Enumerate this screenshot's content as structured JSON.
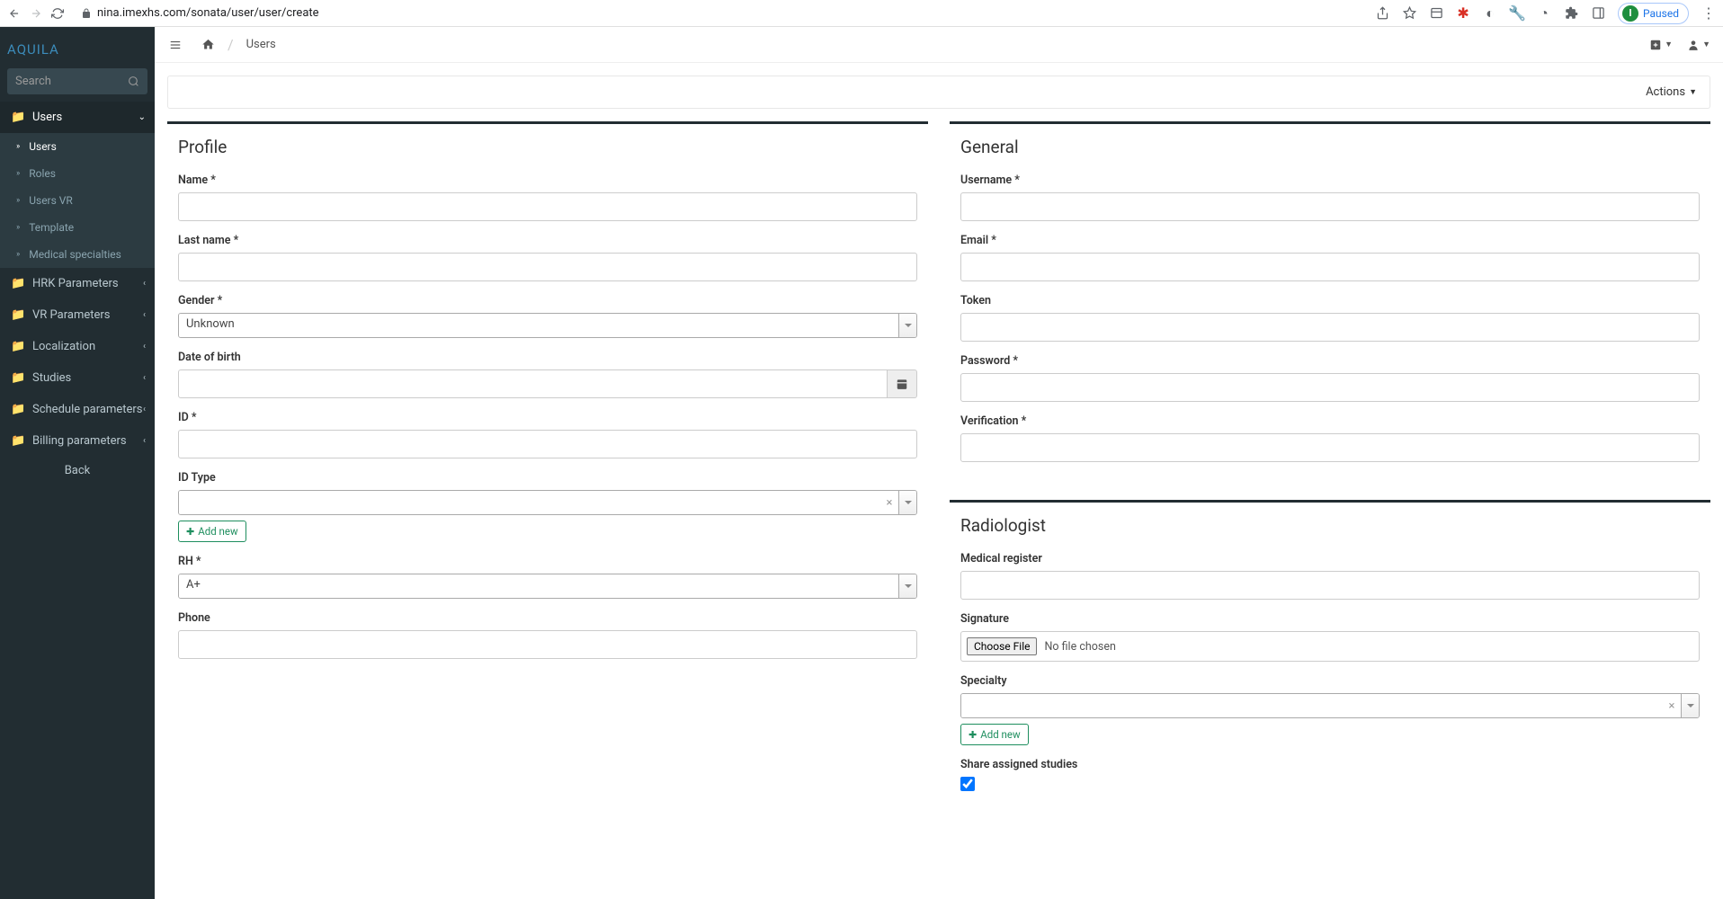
{
  "browser": {
    "url": "nina.imexhs.com/sonata/user/user/create",
    "paused_label": "Paused",
    "avatar_letter": "I"
  },
  "brand": "AQUILA",
  "sidebar": {
    "search_placeholder": "Search",
    "menu": [
      {
        "label": "Users",
        "expanded": true,
        "children": [
          {
            "label": "Users"
          },
          {
            "label": "Roles"
          },
          {
            "label": "Users VR"
          },
          {
            "label": "Template"
          },
          {
            "label": "Medical specialties"
          }
        ]
      },
      {
        "label": "HRK Parameters"
      },
      {
        "label": "VR Parameters"
      },
      {
        "label": "Localization"
      },
      {
        "label": "Studies"
      },
      {
        "label": "Schedule parameters"
      },
      {
        "label": "Billing parameters"
      }
    ],
    "back_label": "Back"
  },
  "topbar": {
    "breadcrumb": "Users"
  },
  "actions_label": "Actions",
  "panels": {
    "profile": {
      "title": "Profile",
      "fields": {
        "name": "Name *",
        "last_name": "Last name *",
        "gender": "Gender *",
        "gender_value": "Unknown",
        "dob": "Date of birth",
        "id": "ID *",
        "id_type": "ID Type",
        "add_new": "Add new",
        "rh": "RH *",
        "rh_value": "A+",
        "phone": "Phone"
      }
    },
    "general": {
      "title": "General",
      "fields": {
        "username": "Username *",
        "email": "Email *",
        "token": "Token",
        "password": "Password *",
        "verification": "Verification *"
      }
    },
    "radiologist": {
      "title": "Radiologist",
      "fields": {
        "medical_register": "Medical register",
        "signature": "Signature",
        "choose_file": "Choose File",
        "no_file": "No file chosen",
        "specialty": "Specialty",
        "add_new": "Add new",
        "share": "Share assigned studies"
      }
    }
  }
}
